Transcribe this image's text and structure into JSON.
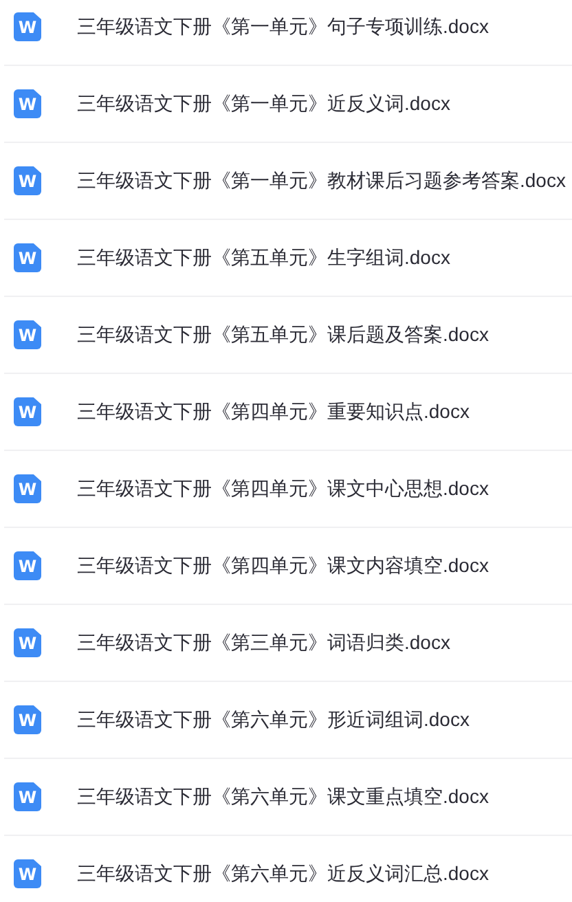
{
  "files": [
    {
      "name": "三年级语文下册《第一单元》句子专项训练.docx",
      "icon_text": "W"
    },
    {
      "name": "三年级语文下册《第一单元》近反义词.docx",
      "icon_text": "W"
    },
    {
      "name": "三年级语文下册《第一单元》教材课后习题参考答案.docx",
      "icon_text": "W"
    },
    {
      "name": "三年级语文下册《第五单元》生字组词.docx",
      "icon_text": "W"
    },
    {
      "name": "三年级语文下册《第五单元》课后题及答案.docx",
      "icon_text": "W"
    },
    {
      "name": "三年级语文下册《第四单元》重要知识点.docx",
      "icon_text": "W"
    },
    {
      "name": "三年级语文下册《第四单元》课文中心思想.docx",
      "icon_text": "W"
    },
    {
      "name": "三年级语文下册《第四单元》课文内容填空.docx",
      "icon_text": "W"
    },
    {
      "name": "三年级语文下册《第三单元》词语归类.docx",
      "icon_text": "W"
    },
    {
      "name": "三年级语文下册《第六单元》形近词组词.docx",
      "icon_text": "W"
    },
    {
      "name": "三年级语文下册《第六单元》课文重点填空.docx",
      "icon_text": "W"
    },
    {
      "name": "三年级语文下册《第六单元》近反义词汇总.docx",
      "icon_text": "W"
    }
  ]
}
